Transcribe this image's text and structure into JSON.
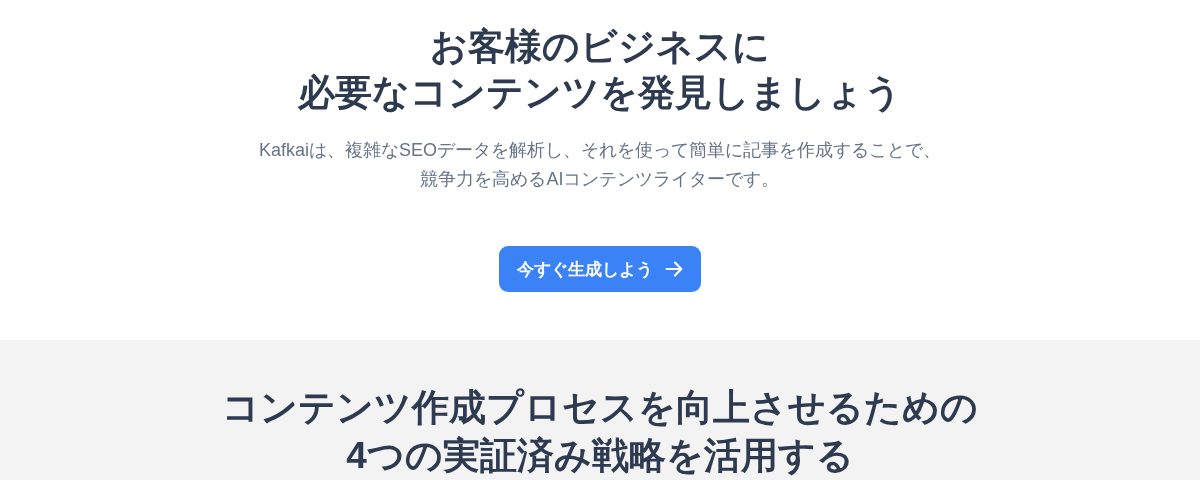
{
  "hero": {
    "title_lines": [
      "お客様のビジネスに",
      "必要なコンテンツを発見しましょう"
    ],
    "subtitle_lines": [
      "Kafkaiは、複雑なSEOデータを解析し、それを使って簡単に記事を作成することで、",
      "競争力を高めるAIコンテンツライターです。"
    ],
    "cta": {
      "label": "今すぐ生成しよう"
    }
  },
  "features": {
    "title_lines": [
      "コンテンツ作成プロセスを向上させるための",
      "4つの実証済み戦略を活用する"
    ]
  }
}
